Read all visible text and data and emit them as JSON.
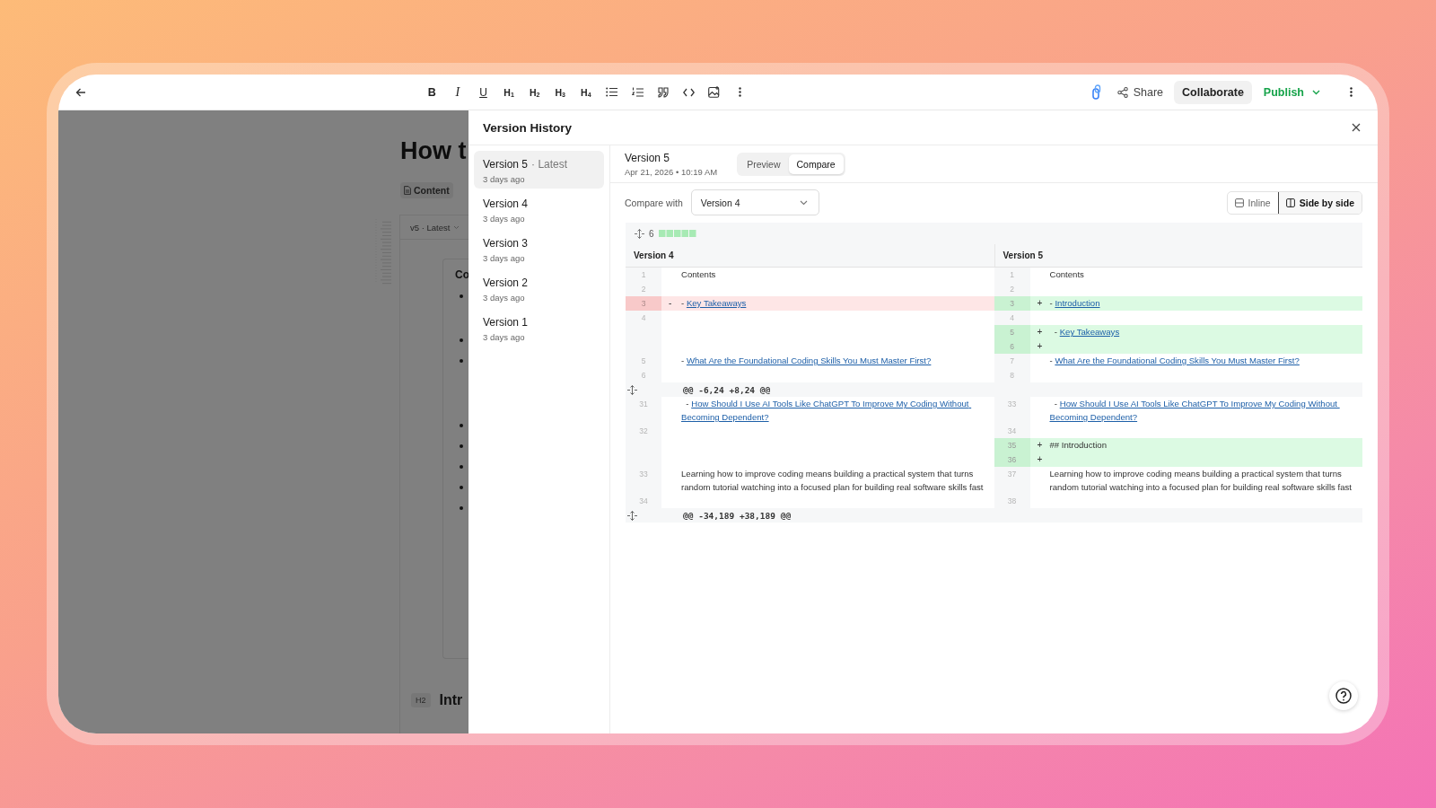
{
  "toolbar": {
    "tools": [
      {
        "kind": "bold",
        "label": "B"
      },
      {
        "kind": "italic",
        "label": "I"
      },
      {
        "kind": "underline",
        "label": "U"
      },
      {
        "kind": "heading",
        "label": "H$_{1}$"
      },
      {
        "kind": "heading",
        "label": "H$_{2}$"
      },
      {
        "kind": "heading",
        "label": "H$_{3}$"
      },
      {
        "kind": "heading",
        "label": "H$_{4}$"
      },
      {
        "kind": "bullet-list"
      },
      {
        "kind": "numbered-list"
      },
      {
        "kind": "quote"
      },
      {
        "kind": "code"
      },
      {
        "kind": "image"
      },
      {
        "kind": "more"
      }
    ],
    "share": "Share",
    "collaborate": "Collaborate",
    "publish": "Publish"
  },
  "editor": {
    "title": "How t",
    "chip": "Content",
    "version_select": "v5 · Latest",
    "card_heading": "Co",
    "heading_tag": "H2",
    "heading": "Intr"
  },
  "panel": {
    "title": "Version History",
    "versions": [
      {
        "title": "Version 5",
        "tag": "· Latest",
        "time": "3 days ago",
        "selected": true
      },
      {
        "title": "Version 4",
        "time": "3 days ago",
        "selected": false
      },
      {
        "title": "Version 3",
        "time": "3 days ago",
        "selected": false
      },
      {
        "title": "Version 2",
        "time": "3 days ago",
        "selected": false
      },
      {
        "title": "Version 1",
        "time": "3 days ago",
        "selected": false
      }
    ],
    "current": {
      "title": "Version 5",
      "date": "Apr 21, 2026 • 10:19 AM"
    },
    "modes": [
      {
        "label": "Preview",
        "selected": false
      },
      {
        "label": "Compare",
        "selected": true
      }
    ],
    "compare_label": "Compare with",
    "compare_value": "Version 4",
    "layouts": [
      {
        "kind": "inline",
        "label": "Inline",
        "selected": false
      },
      {
        "kind": "split",
        "label": "Side by side",
        "selected": true
      }
    ],
    "diff": {
      "changes": "6",
      "left_title": "Version 4",
      "right_title": "Version 5",
      "rows": [
        {
          "kind": "line",
          "left": {
            "kind": "context",
            "num": "1",
            "text": "Contents"
          },
          "right": {
            "kind": "context",
            "num": "1",
            "text": "Contents"
          }
        },
        {
          "kind": "line",
          "left": {
            "kind": "context",
            "num": "2"
          },
          "right": {
            "kind": "context",
            "num": "2"
          }
        },
        {
          "kind": "line",
          "left": {
            "kind": "removed",
            "num": "3",
            "sign": "-",
            "text": "- ",
            "link": "Key Takeaways"
          },
          "right": {
            "kind": "added",
            "num": "3",
            "sign": "+",
            "text": "- ",
            "link": "Introduction"
          }
        },
        {
          "kind": "line",
          "left": {
            "kind": "context",
            "num": "4"
          },
          "right": {
            "kind": "context",
            "num": "4"
          }
        },
        {
          "kind": "line",
          "left": {
            "kind": "blank"
          },
          "right": {
            "kind": "added",
            "num": "5",
            "sign": "+",
            "text": "  - ",
            "link": "Key Takeaways"
          }
        },
        {
          "kind": "line",
          "left": {
            "kind": "blank"
          },
          "right": {
            "kind": "added",
            "num": "6",
            "sign": "+"
          }
        },
        {
          "kind": "line",
          "left": {
            "kind": "context",
            "num": "5",
            "text": "- ",
            "link": "What Are the Foundational Coding Skills You Must Master First?"
          },
          "right": {
            "kind": "context",
            "num": "7",
            "text": "- ",
            "link": "What Are the Foundational Coding Skills You Must Master First?"
          }
        },
        {
          "kind": "line",
          "left": {
            "kind": "context",
            "num": "6"
          },
          "right": {
            "kind": "context",
            "num": "8"
          }
        },
        {
          "kind": "hunk",
          "text": "@@ -6,24 +8,24 @@"
        },
        {
          "kind": "line",
          "left": {
            "kind": "context",
            "num": "31",
            "text": "  - ",
            "link": "How Should I Use AI Tools Like ChatGPT To Improve My Coding Without Becoming Dependent?"
          },
          "right": {
            "kind": "context",
            "num": "33",
            "text": "  - ",
            "link": "How Should I Use AI Tools Like ChatGPT To Improve My Coding Without Becoming Dependent?"
          }
        },
        {
          "kind": "line",
          "left": {
            "kind": "context",
            "num": "32"
          },
          "right": {
            "kind": "context",
            "num": "34"
          }
        },
        {
          "kind": "line",
          "left": {
            "kind": "blank"
          },
          "right": {
            "kind": "added",
            "num": "35",
            "sign": "+",
            "text": "## Introduction"
          }
        },
        {
          "kind": "line",
          "left": {
            "kind": "blank"
          },
          "right": {
            "kind": "added",
            "num": "36",
            "sign": "+"
          }
        },
        {
          "kind": "line",
          "left": {
            "kind": "context",
            "num": "33",
            "text": "Learning how to improve coding means building a practical system that turns random tutorial watching into a focused plan for building real software skills fast"
          },
          "right": {
            "kind": "context",
            "num": "37",
            "text": "Learning how to improve coding means building a practical system that turns random tutorial watching into a focused plan for building real software skills fast"
          }
        },
        {
          "kind": "line",
          "left": {
            "kind": "context",
            "num": "34"
          },
          "right": {
            "kind": "context",
            "num": "38"
          }
        },
        {
          "kind": "hunk",
          "text": "@@ -34,189 +38,189 @@"
        }
      ]
    }
  }
}
